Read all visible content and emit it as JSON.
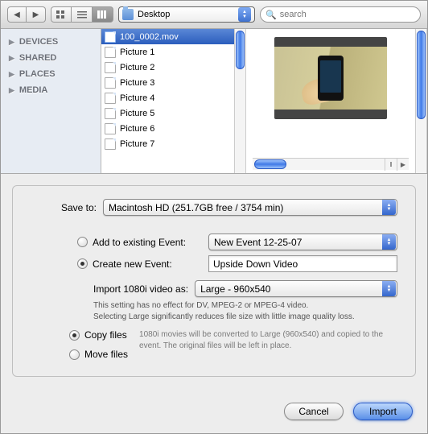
{
  "toolbar": {
    "path_label": "Desktop",
    "search_placeholder": "search"
  },
  "sidebar": {
    "sections": [
      "DEVICES",
      "SHARED",
      "PLACES",
      "MEDIA"
    ]
  },
  "files": [
    {
      "name": "100_0002.mov",
      "selected": true
    },
    {
      "name": "Picture 1",
      "selected": false
    },
    {
      "name": "Picture 2",
      "selected": false
    },
    {
      "name": "Picture 3",
      "selected": false
    },
    {
      "name": "Picture 4",
      "selected": false
    },
    {
      "name": "Picture 5",
      "selected": false
    },
    {
      "name": "Picture 6",
      "selected": false
    },
    {
      "name": "Picture 7",
      "selected": false
    }
  ],
  "form": {
    "save_to_label": "Save to:",
    "save_to_value": "Macintosh HD (251.7GB free / 3754 min)",
    "add_existing_label": "Add to existing Event:",
    "existing_event_value": "New Event 12-25-07",
    "create_new_label": "Create new Event:",
    "new_event_value": "Upside Down Video",
    "import_as_label": "Import 1080i video as:",
    "import_as_value": "Large - 960x540",
    "hint1": "This setting has no effect for DV, MPEG-2 or MPEG-4 video.",
    "hint2": "Selecting Large significantly reduces file size with little image quality loss.",
    "copy_label": "Copy files",
    "move_label": "Move files",
    "copy_hint": "1080i movies will be converted to Large (960x540) and copied to the event. The original files will be left in place."
  },
  "footer": {
    "cancel": "Cancel",
    "import": "Import"
  }
}
